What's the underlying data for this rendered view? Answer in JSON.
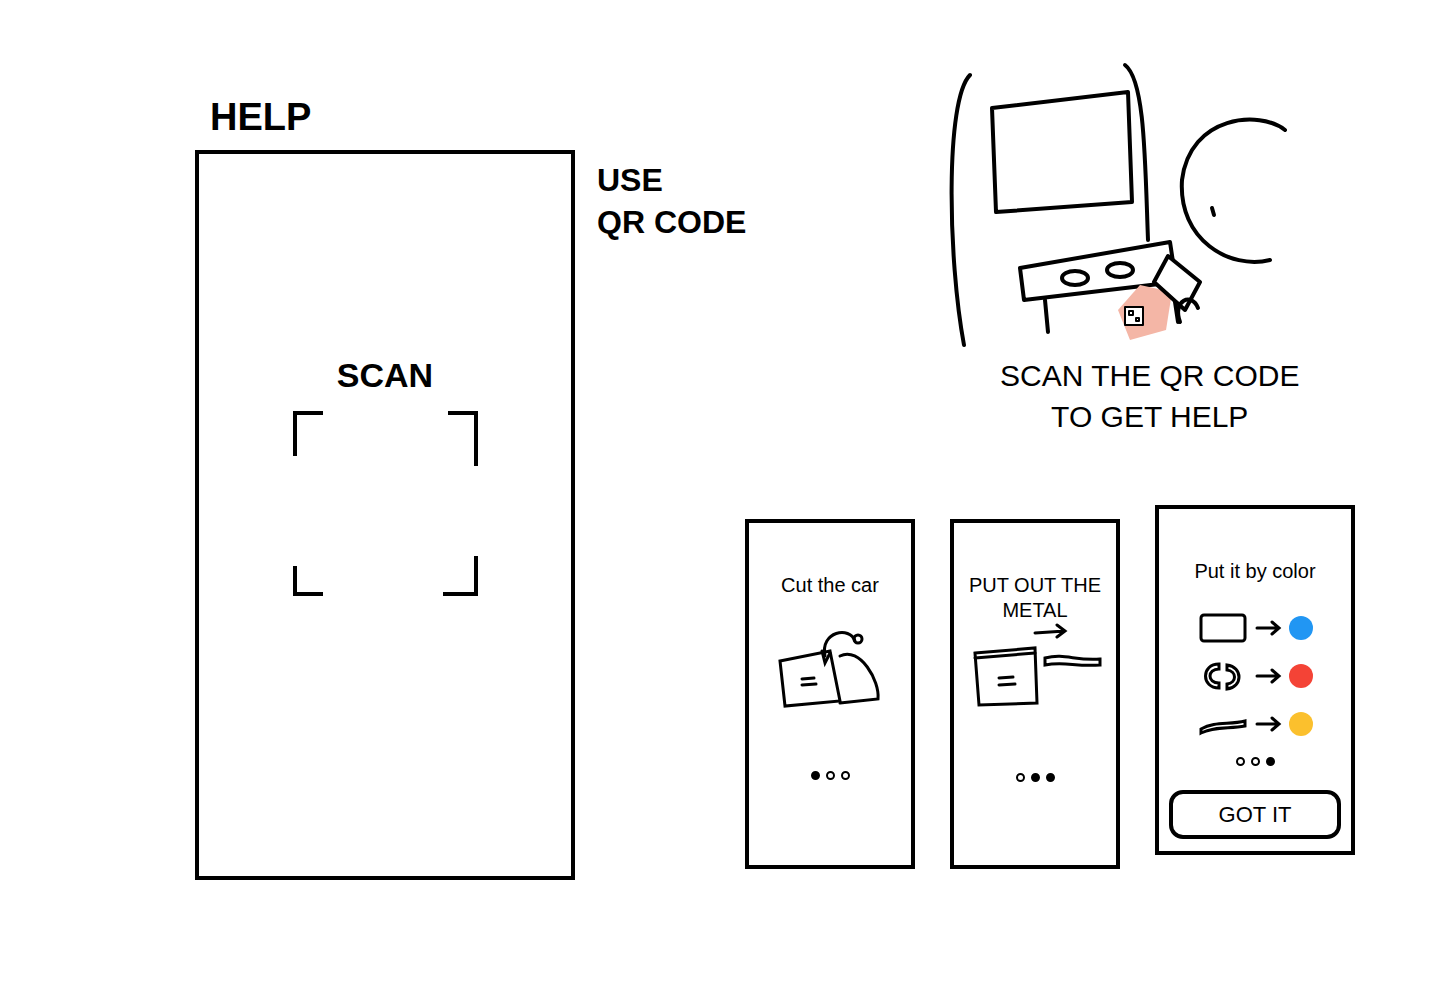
{
  "help_screen": {
    "title": "HELP",
    "scan_label": "SCAN"
  },
  "note": {
    "lines": [
      "USE",
      "QR CODE"
    ]
  },
  "illustration": {
    "caption_lines": [
      "SCAN THE QR CODE",
      "TO GET HELP"
    ]
  },
  "steps": [
    {
      "title": "Cut the car",
      "kind": "cut",
      "dots": [
        {
          "selected": true
        },
        {
          "selected": false
        },
        {
          "selected": false
        }
      ]
    },
    {
      "title": "PUT OUT THE METAL",
      "kind": "metal",
      "dots": [
        {
          "selected": false
        },
        {
          "selected": true
        },
        {
          "selected": true
        }
      ]
    },
    {
      "title": "Put it by color",
      "kind": "sort",
      "dots": [
        {
          "selected": false
        },
        {
          "selected": false
        },
        {
          "selected": true
        }
      ],
      "sort_rows": [
        {
          "shape": "box",
          "color": "#2196f3"
        },
        {
          "shape": "arcs",
          "color": "#f44336"
        },
        {
          "shape": "bar",
          "color": "#fbc02d"
        }
      ],
      "button": "GOT IT"
    }
  ]
}
